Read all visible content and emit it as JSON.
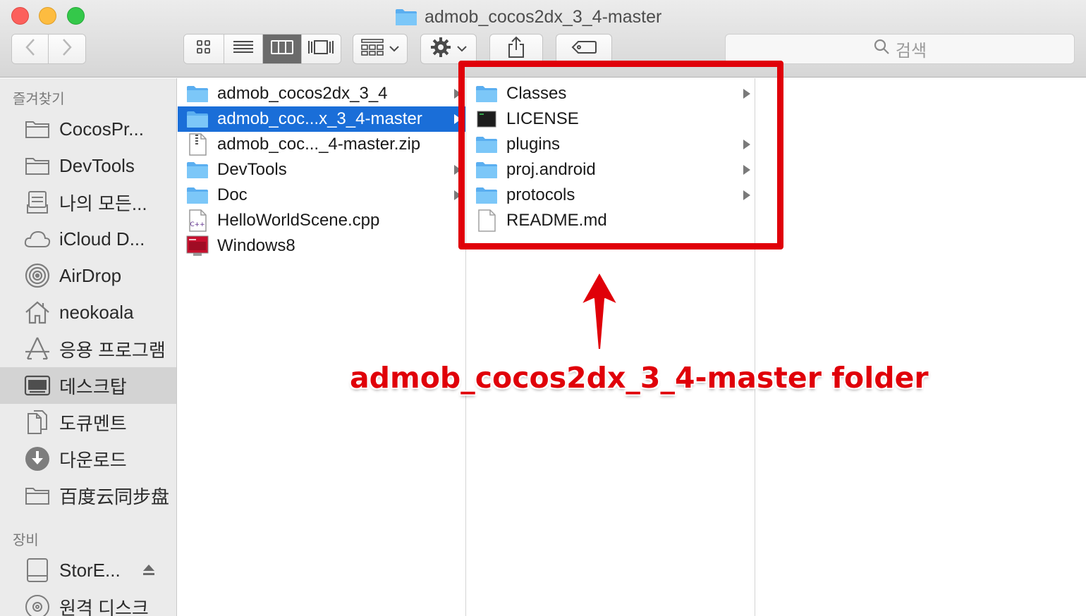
{
  "window": {
    "title": "admob_cocos2dx_3_4-master",
    "title_icon": "folder-icon"
  },
  "toolbar": {
    "back_icon": "chevron-left-icon",
    "forward_icon": "chevron-right-icon",
    "view_modes": [
      {
        "icon": "icon-view-icon",
        "active": false
      },
      {
        "icon": "list-view-icon",
        "active": false
      },
      {
        "icon": "column-view-icon",
        "active": true
      },
      {
        "icon": "coverflow-view-icon",
        "active": false
      }
    ],
    "arrange_icon": "arrange-grid-icon",
    "action_icon": "gear-icon",
    "share_icon": "share-icon",
    "tag_icon": "tag-icon",
    "search_placeholder": "검색"
  },
  "sidebar": {
    "favorites_header": "즐겨찾기",
    "favorites": [
      {
        "label": "CocosPr...",
        "icon": "folder-icon",
        "selected": false
      },
      {
        "label": "DevTools",
        "icon": "folder-icon",
        "selected": false
      },
      {
        "label": "나의 모든...",
        "icon": "all-my-files-icon",
        "selected": false
      },
      {
        "label": "iCloud D...",
        "icon": "cloud-icon",
        "selected": false
      },
      {
        "label": "AirDrop",
        "icon": "airdrop-icon",
        "selected": false
      },
      {
        "label": "neokoala",
        "icon": "home-icon",
        "selected": false
      },
      {
        "label": "응용 프로그램",
        "icon": "applications-icon",
        "selected": false
      },
      {
        "label": "데스크탑",
        "icon": "desktop-icon",
        "selected": true
      },
      {
        "label": "도큐멘트",
        "icon": "documents-icon",
        "selected": false
      },
      {
        "label": "다운로드",
        "icon": "downloads-icon",
        "selected": false
      },
      {
        "label": "百度云同步盘",
        "icon": "folder-icon",
        "selected": false
      }
    ],
    "devices_header": "장비",
    "devices": [
      {
        "label": "StorE...",
        "icon": "drive-icon",
        "eject": true
      },
      {
        "label": "원격 디스크",
        "icon": "remote-disc-icon",
        "eject": false
      }
    ]
  },
  "column1": [
    {
      "name": "admob_cocos2dx_3_4",
      "icon": "folder-icon",
      "has_children": true,
      "selected": false
    },
    {
      "name": "admob_coc...x_3_4-master",
      "icon": "folder-icon",
      "has_children": true,
      "selected": true
    },
    {
      "name": "admob_coc..._4-master.zip",
      "icon": "zip-file-icon",
      "has_children": false,
      "selected": false
    },
    {
      "name": "DevTools",
      "icon": "folder-icon",
      "has_children": true,
      "selected": false
    },
    {
      "name": "Doc",
      "icon": "folder-icon",
      "has_children": true,
      "selected": false
    },
    {
      "name": "HelloWorldScene.cpp",
      "icon": "cpp-file-icon",
      "has_children": false,
      "selected": false
    },
    {
      "name": "Windows8",
      "icon": "parallels-vm-icon",
      "has_children": false,
      "selected": false
    }
  ],
  "column2": [
    {
      "name": "Classes",
      "icon": "folder-icon",
      "has_children": true
    },
    {
      "name": "LICENSE",
      "icon": "terminal-file-icon",
      "has_children": false
    },
    {
      "name": "plugins",
      "icon": "folder-icon",
      "has_children": true
    },
    {
      "name": "proj.android",
      "icon": "folder-icon",
      "has_children": true
    },
    {
      "name": "protocols",
      "icon": "folder-icon",
      "has_children": true
    },
    {
      "name": "README.md",
      "icon": "text-file-icon",
      "has_children": false
    }
  ],
  "annotation": {
    "caption": "admob_cocos2dx_3_4-master folder",
    "color": "#e00009"
  },
  "colors": {
    "selection": "#1a6ed8",
    "folder": "#6cbff5",
    "annotation": "#e00009"
  }
}
